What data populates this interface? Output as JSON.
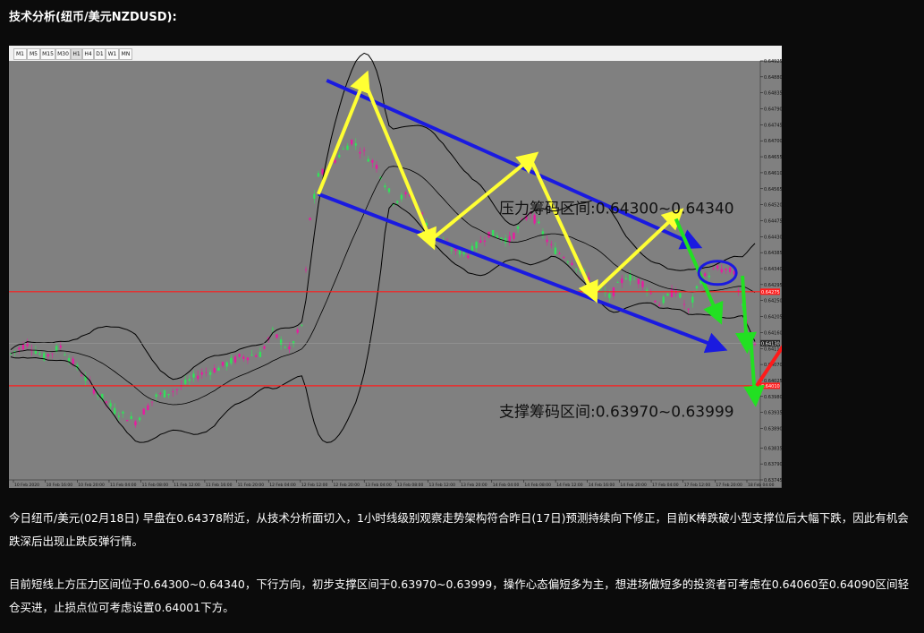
{
  "page": {
    "title": "技术分析(纽币/美元NZDUSD):",
    "paragraph1": "今日纽币/美元(02月18日) 早盘在0.64378附近，从技术分析面切入，1小时线级别观察走势架构符合昨日(17日)预测持续向下修正，目前K棒跌破小型支撑位后大幅下跌，因此有机会跌深后出现止跌反弹行情。",
    "paragraph2": "目前短线上方压力区间位于0.64300~0.64340，下行方向，初步支撑区间于0.63970~0.63999，操作心态偏短多为主，想进场做短多的投资者可考虑在0.64060至0.64090区间轻仓买进，止损点位可考虑设置0.64001下方。"
  },
  "toolbar": {
    "timeframes": [
      "M1",
      "M5",
      "M15",
      "M30",
      "H1",
      "H4",
      "D1",
      "W1",
      "MN"
    ]
  },
  "chart_data": {
    "type": "candlestick",
    "symbol": "NZDUSD",
    "timeframe": "H1",
    "ylim": [
      0.63745,
      0.64925
    ],
    "y_ticks": [
      0.64925,
      0.6488,
      0.64835,
      0.6479,
      0.64745,
      0.647,
      0.64655,
      0.6461,
      0.64565,
      0.6452,
      0.64475,
      0.6443,
      0.64385,
      0.6434,
      0.64295,
      0.6425,
      0.64205,
      0.6416,
      0.64115,
      0.6407,
      0.64025,
      0.6398,
      0.63935,
      0.6389,
      0.63835,
      0.6379,
      0.63745
    ],
    "x_ticks": [
      "10 Feb 2020",
      "10 Feb 16:00",
      "10 Feb 20:00",
      "11 Feb 04:00",
      "11 Feb 08:00",
      "11 Feb 12:00",
      "11 Feb 16:00",
      "11 Feb 20:00",
      "12 Feb 04:00",
      "12 Feb 12:00",
      "12 Feb 20:00",
      "13 Feb 04:00",
      "13 Feb 08:00",
      "13 Feb 12:00",
      "13 Feb 20:00",
      "14 Feb 04:00",
      "14 Feb 08:00",
      "14 Feb 12:00",
      "14 Feb 16:00",
      "14 Feb 20:00",
      "17 Feb 04:00",
      "17 Feb 12:00",
      "17 Feb 20:00",
      "18 Feb 04:00"
    ],
    "candle_count": 180,
    "horizontal_lines": [
      0.64275,
      0.6401
    ],
    "price_line": 0.6413,
    "price_tags": [
      "0.64275",
      "0.64130",
      "0.64010"
    ],
    "annotations": {
      "resistance": "压力筹码区间:0.64300~0.64340",
      "support": "支撑筹码区间:0.63970~0.63999"
    },
    "colors": {
      "background": "#808080",
      "bull": "#32e05a",
      "bear": "#e81aa0",
      "channel": "#1a1ae0",
      "zigzag": "#ffff33",
      "green_path": "#22e022",
      "red_arrow": "#ff1a1a",
      "band": "#000000",
      "level_line": "#ff1a1a"
    }
  }
}
